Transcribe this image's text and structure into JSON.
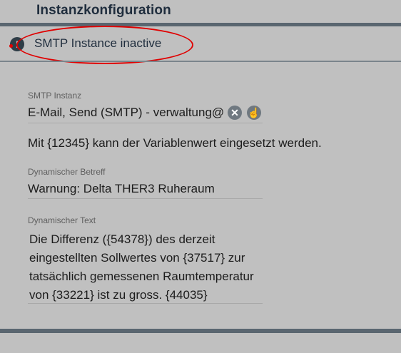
{
  "header": {
    "title": "Instanzkonfiguration"
  },
  "status": {
    "text": "SMTP Instance inactive",
    "icon": "exclamation-alert-icon"
  },
  "smtp": {
    "label": "SMTP Instanz",
    "value": "E-Mail, Send (SMTP) - verwaltung@i",
    "clear_icon": "clear-icon",
    "pick_icon": "pointer-select-icon"
  },
  "hint": "Mit {12345} kann der Variablenwert eingesetzt werden.",
  "subject": {
    "label": "Dynamischer Betreff",
    "value": "Warnung: Delta THER3 Ruheraum"
  },
  "body": {
    "label": "Dynamischer Text",
    "lines": [
      "Die Differenz ({54378}) des derzeit",
      "eingestellten Sollwertes von {37517} zur",
      "tatsächlich gemessenen Raumtemperatur",
      "von {33221} ist zu gross. {44035}"
    ]
  },
  "colors": {
    "background": "#c0c0c0",
    "bar": "#5a6670",
    "alert": "#e00000"
  }
}
